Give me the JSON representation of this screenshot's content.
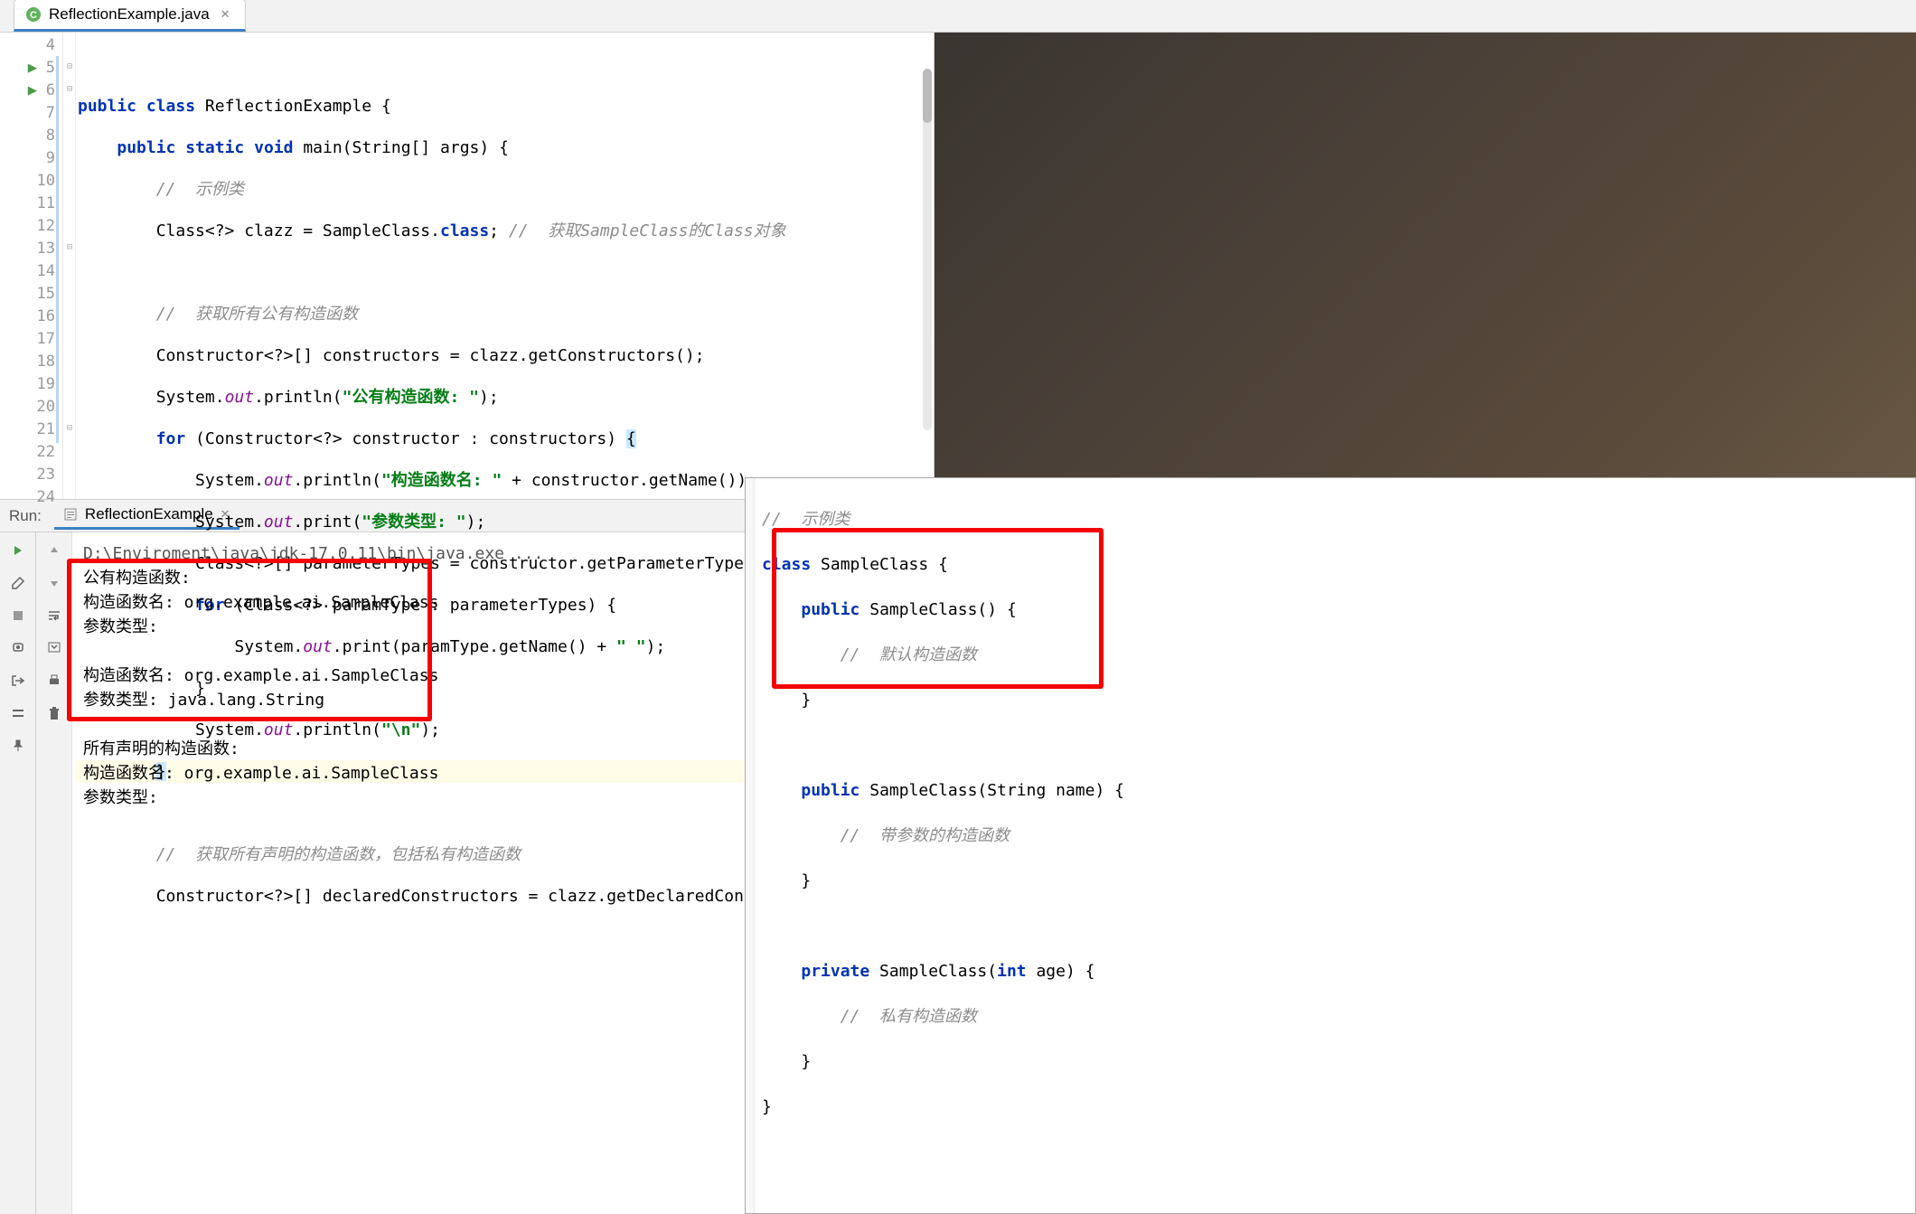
{
  "tab": {
    "filename": "ReflectionExample.java"
  },
  "editor": {
    "lines": [
      {
        "n": 4,
        "run": false
      },
      {
        "n": 5,
        "run": true
      },
      {
        "n": 6,
        "run": true
      },
      {
        "n": 7,
        "run": false
      },
      {
        "n": 8,
        "run": false
      },
      {
        "n": 9,
        "run": false
      },
      {
        "n": 10,
        "run": false
      },
      {
        "n": 11,
        "run": false
      },
      {
        "n": 12,
        "run": false
      },
      {
        "n": 13,
        "run": false
      },
      {
        "n": 14,
        "run": false
      },
      {
        "n": 15,
        "run": false
      },
      {
        "n": 16,
        "run": false
      },
      {
        "n": 17,
        "run": false
      },
      {
        "n": 18,
        "run": false
      },
      {
        "n": 19,
        "run": false
      },
      {
        "n": 20,
        "run": false
      },
      {
        "n": 21,
        "run": false
      },
      {
        "n": 22,
        "run": false
      },
      {
        "n": 23,
        "run": false
      },
      {
        "n": 24,
        "run": false
      }
    ],
    "code": {
      "l5_kw1": "public",
      "l5_kw2": "class",
      "l5_cls": "ReflectionExample",
      "l5_brace": " {",
      "l6_kw1": "public",
      "l6_kw2": "static",
      "l6_kw3": "void",
      "l6_m": "main",
      "l6_rest": "(String[] args) {",
      "l7_com": "//  示例类",
      "l8_pre": "Class<?> clazz = SampleClass.",
      "l8_kw": "class",
      "l8_semi": ";",
      "l8_com": " //  获取SampleClass的Class对象",
      "l10_com": "//  获取所有公有构造函数",
      "l11": "Constructor<?>[] constructors = clazz.getConstructors();",
      "l12_pre": "System.",
      "l12_out": "out",
      "l12_mid": ".println(",
      "l12_str": "\"公有构造函数: \"",
      "l12_end": ");",
      "l13_kw": "for",
      "l13_rest": " (Constructor<?> constructor : constructors) ",
      "l13_brace": "{",
      "l14_pre": "System.",
      "l14_out": "out",
      "l14_mid": ".println(",
      "l14_str": "\"构造函数名: \"",
      "l14_end": " + constructor.getName());",
      "l15_pre": "System.",
      "l15_out": "out",
      "l15_mid": ".print(",
      "l15_str": "\"参数类型: \"",
      "l15_end": ");",
      "l16": "Class<?>[] parameterTypes = constructor.getParameterTypes();",
      "l17_kw": "for",
      "l17_rest": " (Class<?> paramType : parameterTypes) {",
      "l18_pre": "System.",
      "l18_out": "out",
      "l18_mid": ".print(paramType.getName() + ",
      "l18_str": "\" \"",
      "l18_end": ");",
      "l19": "}",
      "l20_pre": "System.",
      "l20_out": "out",
      "l20_mid": ".println(",
      "l20_str": "\"\\n\"",
      "l20_end": ");",
      "l21": "}",
      "l23_com": "//  获取所有声明的构造函数，包括私有构造函数",
      "l24": "Constructor<?>[] declaredConstructors = clazz.getDeclaredConstructors();"
    }
  },
  "run": {
    "label": "Run:",
    "config": "ReflectionExample",
    "cmd": "D:\\Enviroment\\java\\jdk-17.0.11\\bin\\java.exe ...",
    "out1": "公有构造函数:",
    "out2": "构造函数名: org.example.ai.SampleClass",
    "out3": "参数类型:",
    "out4": "构造函数名: org.example.ai.SampleClass",
    "out5": "参数类型: java.lang.String",
    "out6": "所有声明的构造函数:",
    "out7": "构造函数名: org.example.ai.SampleClass",
    "out8": "参数类型:"
  },
  "secondary": {
    "l1_com": "//  示例类",
    "l2_kw": "class",
    "l2_cls": " SampleClass {",
    "l3_kw": "public",
    "l3_rest": " SampleClass() {",
    "l4_com": "//  默认构造函数",
    "l5": "}",
    "l7_kw": "public",
    "l7_rest": " SampleClass(String name) {",
    "l8_com": "//  带参数的构造函数",
    "l9": "}",
    "l11_kw": "private",
    "l11_rest_a": " SampleClass(",
    "l11_kw2": "int",
    "l11_rest_b": " age) {",
    "l12_com": "//  私有构造函数",
    "l13": "}",
    "l14": "}"
  }
}
